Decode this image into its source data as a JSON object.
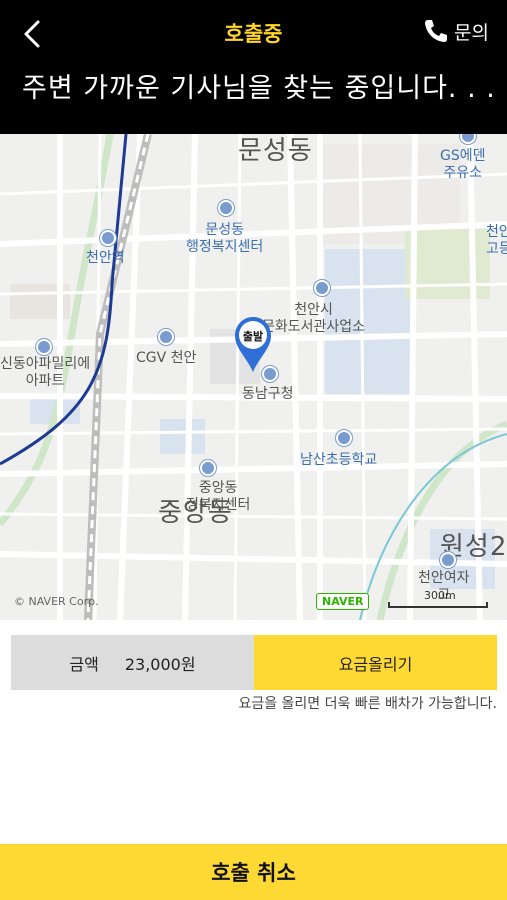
{
  "header": {
    "title": "호출중",
    "inquiry_label": "문의",
    "message": "주변 가까운 기사님을 찾는 중입니다. . ."
  },
  "map": {
    "labels": {
      "munseong_dong": "문성동",
      "gs_station": "GS에덴\n주유소",
      "munseong_center": "문성동\n행정복지센터",
      "cheonan_station": "천안역",
      "cheonan_right": "천안\n고등",
      "library": "천안시\n문화도서관사업소",
      "cgv": "CGV 천안",
      "apartment": "신동아파밀리에\n아파트",
      "dongnam_office": "동남구청",
      "namsan_school": "남산초등학교",
      "jungang_small": "중앙동\n정복지센터",
      "jungang_dong": "중앙동",
      "wonseong": "원성2",
      "cheonan_girls": "천안여자\n고",
      "pin_label": "출발"
    },
    "naver_label": "NAVER",
    "scale_label": "300m",
    "copyright": "© NAVER Corp."
  },
  "fare": {
    "amount_label": "금액",
    "amount_value": "23,000원",
    "raise_button": "요금올리기",
    "hint": "요금을 올리면 더욱 빠른 배차가 가능합니다."
  },
  "cancel_button": "호출 취소",
  "colors": {
    "accent": "#ffd933",
    "title": "#ffd52a",
    "header_bg": "#000000"
  }
}
